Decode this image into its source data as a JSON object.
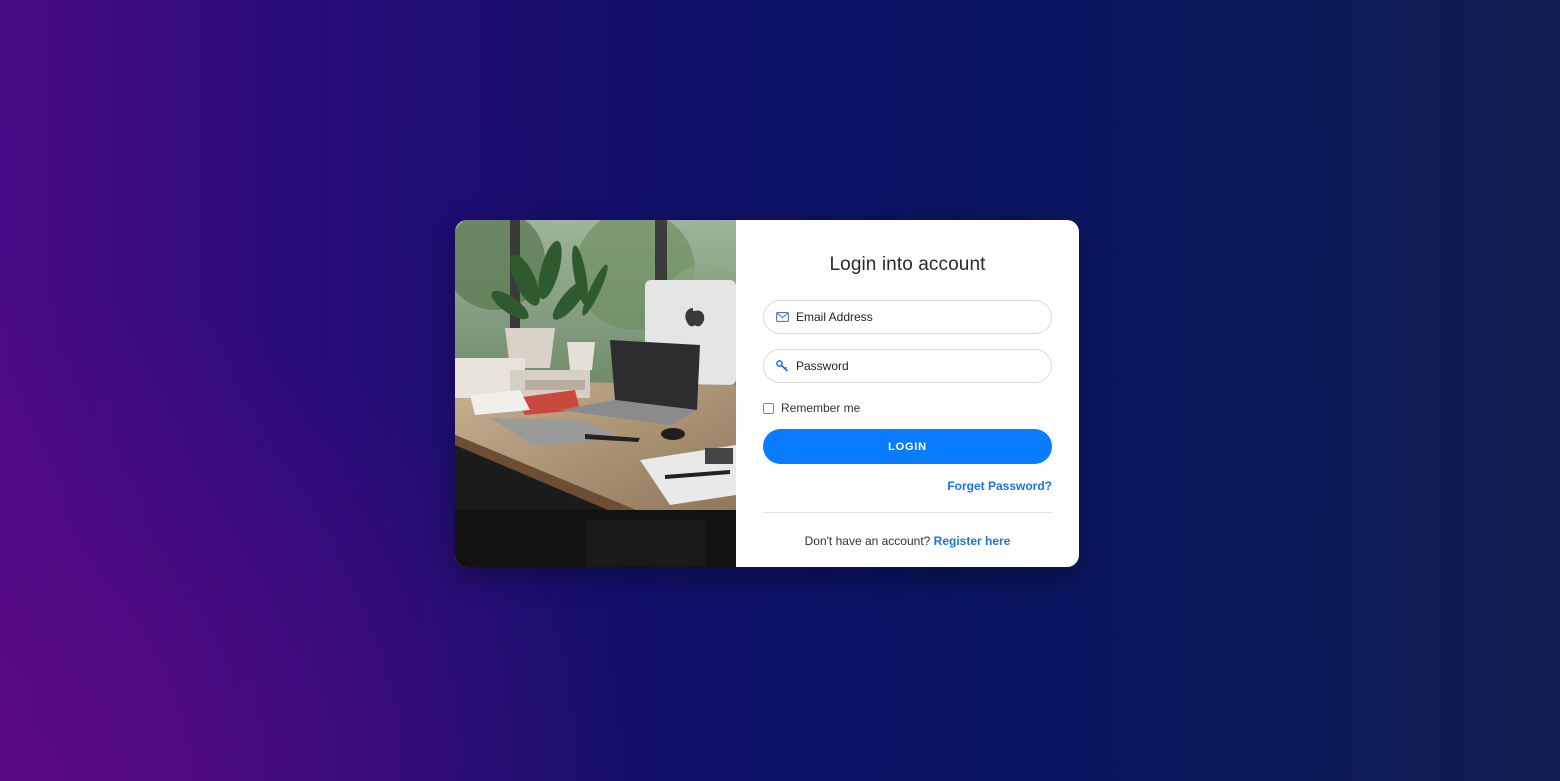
{
  "login": {
    "title": "Login into account",
    "email_placeholder": "Email Address",
    "password_placeholder": "Password",
    "remember_label": "Remember me",
    "login_button": "LOGIN",
    "forgot_link": "Forget Password?",
    "register_prompt": "Don't have an account?",
    "register_link": "Register here"
  },
  "icons": {
    "email": "envelope-icon",
    "password": "key-icon"
  },
  "colors": {
    "accent": "#0a7cff",
    "link": "#1a73e8"
  }
}
